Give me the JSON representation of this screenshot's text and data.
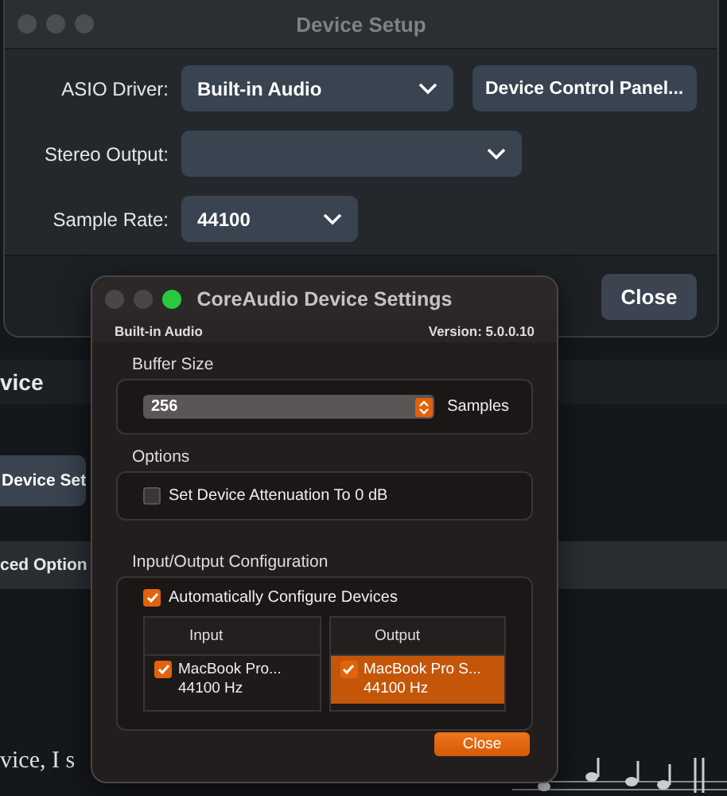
{
  "device_setup": {
    "title": "Device Setup",
    "fields": [
      {
        "label": "ASIO Driver:",
        "kind": "dropdown",
        "value": "Built-in Audio",
        "button": "Device Control Panel..."
      },
      {
        "label": "Stereo Output:",
        "kind": "dropdown"
      },
      {
        "label": "Sample Rate:",
        "kind": "dropdown",
        "value": "44100"
      }
    ],
    "close_button": "Close"
  },
  "background": {
    "heading": "vice",
    "button": "Device Set",
    "section": "ced Option",
    "body_text": "vice, I s"
  },
  "coreaudio_dialog": {
    "title": "CoreAudio Device Settings",
    "device": "Built-in Audio",
    "version": "Version: 5.0.0.10",
    "buffer_size": {
      "label": "Buffer Size",
      "value": "256",
      "unit": "Samples"
    },
    "options": {
      "label": "Options",
      "checkbox": {
        "label": "Set Device Attenuation To 0 dB",
        "checked": false
      }
    },
    "io_config": {
      "label": "Input/Output Configuration",
      "auto_configure": {
        "label": "Automatically Configure Devices",
        "checked": true
      },
      "tables": [
        {
          "header": "Input",
          "rows": [
            {
              "name": "MacBook Pro...",
              "rate": "44100 Hz",
              "checked": true,
              "selected": false
            }
          ]
        },
        {
          "header": "Output",
          "rows": [
            {
              "name": "MacBook Pro S...",
              "rate": "44100 Hz",
              "checked": true,
              "selected": true
            }
          ]
        }
      ]
    },
    "close_button": "Close"
  }
}
